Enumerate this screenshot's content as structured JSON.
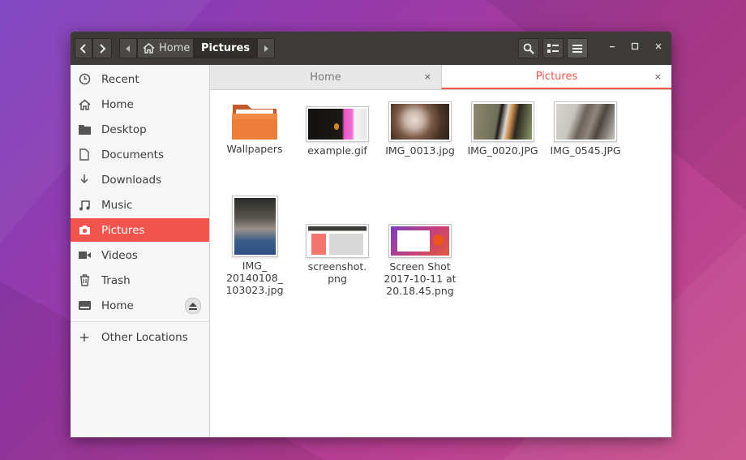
{
  "headerbar": {
    "back_icon": "chevron-left",
    "forward_icon": "chevron-right",
    "path": [
      {
        "label": "Home",
        "icon": "home-icon"
      },
      {
        "label": "Pictures"
      }
    ],
    "view_buttons": [
      "search-icon",
      "list-view-icon",
      "menu-icon"
    ],
    "window_controls": [
      "minimize",
      "maximize",
      "close"
    ]
  },
  "sidebar": {
    "items": [
      {
        "label": "Recent",
        "icon": "clock-icon"
      },
      {
        "label": "Home",
        "icon": "home-icon"
      },
      {
        "label": "Desktop",
        "icon": "folder-icon"
      },
      {
        "label": "Documents",
        "icon": "document-icon"
      },
      {
        "label": "Downloads",
        "icon": "download-icon"
      },
      {
        "label": "Music",
        "icon": "music-icon"
      },
      {
        "label": "Pictures",
        "icon": "camera-icon",
        "active": true
      },
      {
        "label": "Videos",
        "icon": "video-icon"
      },
      {
        "label": "Trash",
        "icon": "trash-icon"
      },
      {
        "label": "Home",
        "icon": "drive-icon"
      }
    ],
    "other_locations": "Other Locations"
  },
  "tabs": [
    {
      "label": "Home",
      "close": "×"
    },
    {
      "label": "Pictures",
      "close": "×",
      "active": true
    }
  ],
  "files": [
    {
      "name": "Wallpapers",
      "type": "folder"
    },
    {
      "name": "example.gif",
      "type": "image"
    },
    {
      "name": "IMG_0013.jpg",
      "type": "image"
    },
    {
      "name": "IMG_0020.JPG",
      "type": "image"
    },
    {
      "name": "IMG_0545.JPG",
      "type": "image"
    },
    {
      "name": "IMG_\n20140108_\n103023.jpg",
      "type": "image"
    },
    {
      "name": "screenshot.\npng",
      "type": "image"
    },
    {
      "name": "Screen Shot\n2017-10-11 at\n20.18.45.png",
      "type": "image"
    }
  ],
  "colors": {
    "accent": "#f0544c",
    "headerbar": "#3c3b37"
  }
}
